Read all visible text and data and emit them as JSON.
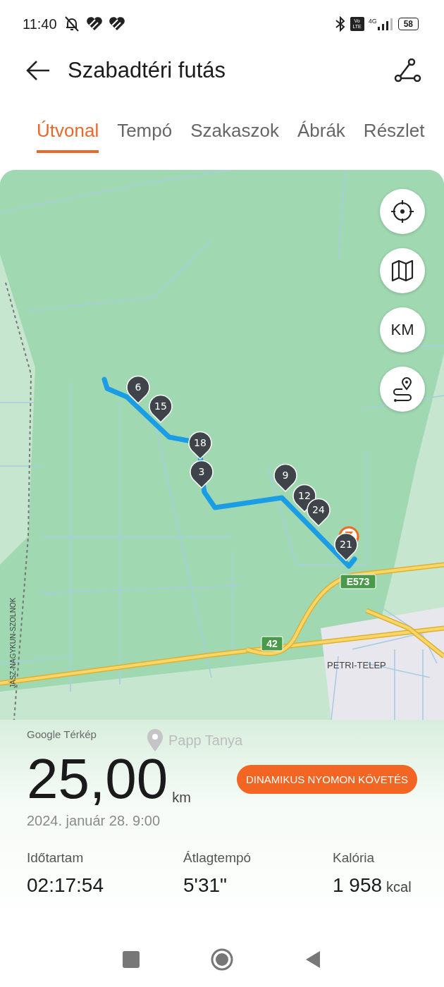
{
  "status_bar": {
    "time": "11:40",
    "network": "4G",
    "volte": "Vo LTE",
    "battery": "58"
  },
  "header": {
    "title": "Szabadtéri futás"
  },
  "tabs": [
    {
      "label": "Útvonal",
      "selected": true
    },
    {
      "label": "Tempó",
      "selected": false
    },
    {
      "label": "Szakaszok",
      "selected": false
    },
    {
      "label": "Ábrák",
      "selected": false
    },
    {
      "label": "Részlet",
      "selected": false
    }
  ],
  "map": {
    "unit_button": "KM",
    "km_markers": [
      "6",
      "15",
      "18",
      "3",
      "9",
      "12",
      "24",
      "21"
    ],
    "road_labels": [
      "E573",
      "42"
    ],
    "place_labels": [
      "PETRI-TELEP",
      "JÁSZ-NAGYKUN-SZOLNOK"
    ],
    "attribution": "Google Térkép",
    "poi": "Papp Tanya"
  },
  "summary": {
    "distance": "25,00",
    "unit": "km",
    "date": "2024. január 28. 9:00",
    "button": "DINAMIKUS NYOMON KÖVETÉS",
    "stats": [
      {
        "label": "Időtartam",
        "value": "02:17:54"
      },
      {
        "label": "Átlagtempó",
        "value": "5'31\""
      },
      {
        "label": "Kalória",
        "value": "1 958",
        "unit": "kcal"
      }
    ]
  }
}
